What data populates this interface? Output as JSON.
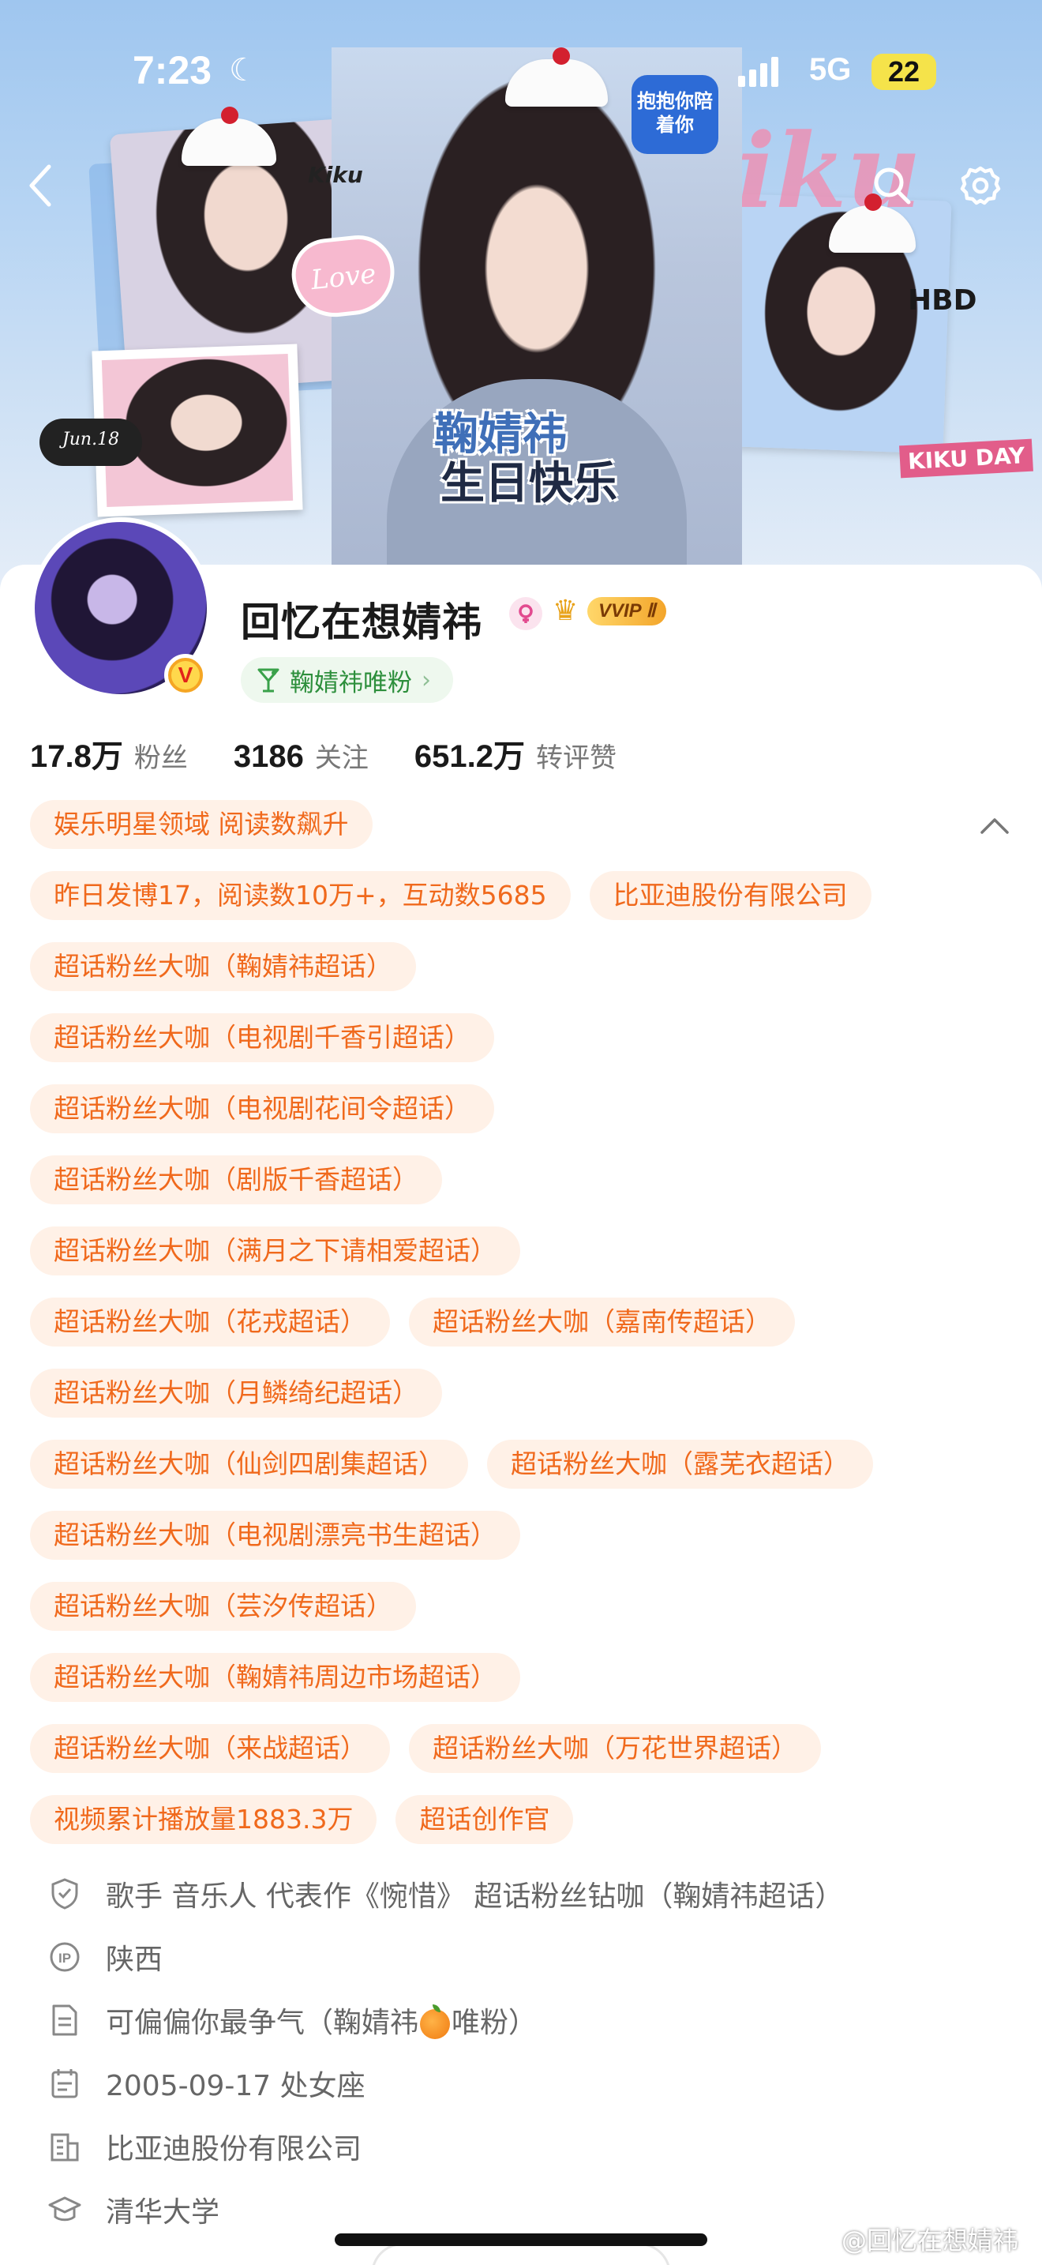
{
  "status_bar": {
    "time": "7:23",
    "network": "5G",
    "battery": "22"
  },
  "banner": {
    "title_line1": "鞠婧祎",
    "title_line2": "生日快乐",
    "big_script": "Kiku",
    "kiku_label": "Kiku",
    "love_label": "Love",
    "date_label": "Jun.18",
    "hbd_label": "HBD",
    "kikuday_label": "KIKU DAY",
    "bubble_label": "抱抱你陪着你"
  },
  "profile": {
    "username": "回忆在想婧祎",
    "vip_label": "VVIP Ⅱ",
    "fan_tag": "鞠婧祎唯粉",
    "verified_mark": "V"
  },
  "stats": [
    {
      "value": "17.8万",
      "label": "粉丝"
    },
    {
      "value": "3186",
      "label": "关注"
    },
    {
      "value": "651.2万",
      "label": "转评赞"
    }
  ],
  "tag_rows": [
    [
      "娱乐明星领域 阅读数飙升"
    ],
    [
      "昨日发博17，阅读数10万+，互动数5685",
      "比亚迪股份有限公司"
    ],
    [
      "超话粉丝大咖（鞠婧祎超话）"
    ],
    [
      "超话粉丝大咖（电视剧千香引超话）"
    ],
    [
      "超话粉丝大咖（电视剧花间令超话）"
    ],
    [
      "超话粉丝大咖（剧版千香超话）"
    ],
    [
      "超话粉丝大咖（满月之下请相爱超话）"
    ],
    [
      "超话粉丝大咖（花戎超话）",
      "超话粉丝大咖（嘉南传超话）"
    ],
    [
      "超话粉丝大咖（月鳞绮纪超话）"
    ],
    [
      "超话粉丝大咖（仙剑四剧集超话）",
      "超话粉丝大咖（露芜衣超话）"
    ],
    [
      "超话粉丝大咖（电视剧漂亮书生超话）"
    ],
    [
      "超话粉丝大咖（芸汐传超话）"
    ],
    [
      "超话粉丝大咖（鞠婧祎周边市场超话）"
    ],
    [
      "超话粉丝大咖（来战超话）",
      "超话粉丝大咖（万花世界超话）"
    ],
    [
      "视频累计播放量1883.3万",
      "超话创作官"
    ]
  ],
  "info": {
    "verification": "歌手 音乐人 代表作《惋惜》 超话粉丝钻咖（鞠婧祎超话）",
    "ip": "陕西",
    "bio_before": "可偏偏你最争气（鞠婧祎",
    "bio_after": "唯粉）",
    "birthday": "2005-09-17 处女座",
    "company": "比亚迪股份有限公司",
    "school": "清华大学"
  },
  "watermark": "@回忆在想婧祎",
  "colors": {
    "tag_bg": "#fff1e7",
    "tag_text": "#f0691c",
    "fan_tag_bg": "#eef8ee",
    "fan_tag_text": "#2d8f3c",
    "vip_gold": "#f3a52a"
  },
  "icons": [
    "back-arrow-icon",
    "search-icon",
    "gear-icon",
    "moon-icon",
    "female-icon",
    "crown-icon",
    "cocktail-icon",
    "chevron-up-icon",
    "shield-icon",
    "ip-icon",
    "document-icon",
    "calendar-icon",
    "building-icon",
    "graduation-cap-icon",
    "weibo-icon"
  ]
}
